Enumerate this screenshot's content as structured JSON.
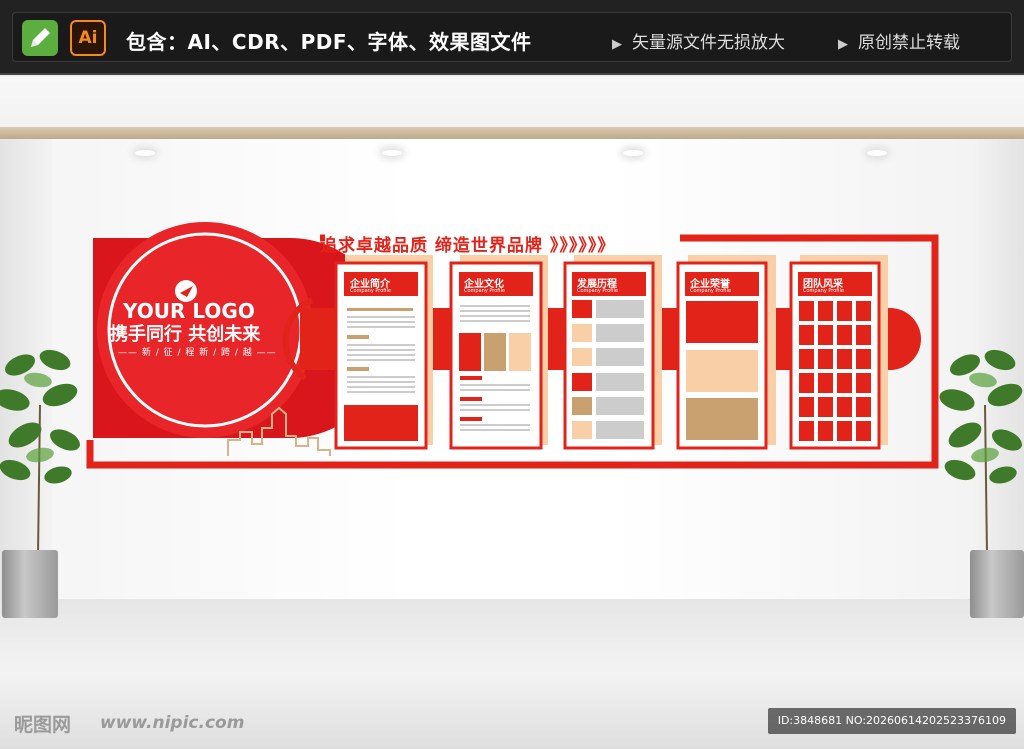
{
  "topbar": {
    "app_icons": [
      {
        "name": "pen-tool-icon",
        "color": "#5cae3f"
      },
      {
        "name": "illustrator-icon",
        "label": "Ai",
        "color": "#f5891f"
      }
    ],
    "includes_text": "包含：AI、CDR、PDF、字体、效果图文件",
    "notes": [
      "矢量源文件无损放大",
      "原创禁止转载"
    ]
  },
  "display": {
    "slogan": "追求卓越品质  缔造世界品牌 》》》》》》",
    "logo_text": "YOUR LOGO",
    "tagline": "携手同行  共创未来",
    "subline": "—— 新 / 征 / 程   新 / 跨 / 越 ——",
    "panels": [
      {
        "title": "企业简介",
        "subtitle": "Company Profile"
      },
      {
        "title": "企业文化",
        "subtitle": "Company Profile"
      },
      {
        "title": "发展历程",
        "subtitle": "Company Profile"
      },
      {
        "title": "企业荣誉",
        "subtitle": "Company Profile"
      },
      {
        "title": "团队风采",
        "subtitle": "Company Profile"
      }
    ],
    "colors": {
      "primary_red": "#e2231a",
      "beige": "#f8cfa6",
      "tan": "#c9a070",
      "gray": "#cccccc"
    }
  },
  "footer": {
    "watermark": "昵图网",
    "url": "www.nipic.com",
    "id_text": "ID:3848681 NO:20260614202523376109"
  }
}
